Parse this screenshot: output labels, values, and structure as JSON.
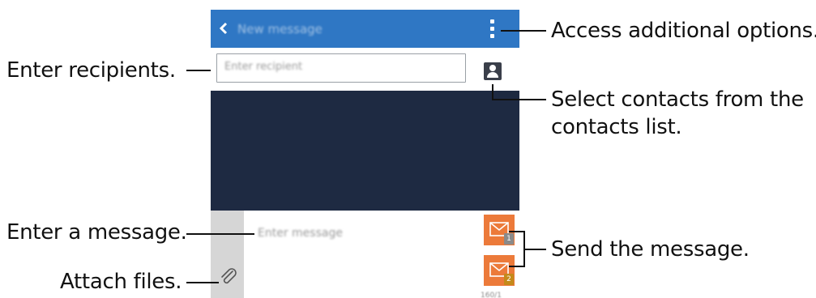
{
  "app": {
    "title": "New message",
    "back_icon": "chevron-left-icon",
    "overflow_icon": "more-vertical-icon"
  },
  "recipient": {
    "placeholder": "Enter recipient",
    "contacts_icon": "contact-person-icon"
  },
  "composer": {
    "placeholder": "Enter message",
    "attach_icon": "paperclip-icon",
    "send_buttons": [
      {
        "icon": "envelope-icon",
        "sim": "1"
      },
      {
        "icon": "envelope-icon",
        "sim": "2"
      }
    ],
    "counter": "160/1"
  },
  "callouts": {
    "options": "Access additional options.",
    "recipients": "Enter recipients.",
    "contacts_line1": "Select contacts from the",
    "contacts_line2": "contacts list.",
    "message": "Enter a message.",
    "send": "Send the message.",
    "attach": "Attach files."
  },
  "colors": {
    "actionbar": "#2f77c4",
    "content": "#1e2a42",
    "send": "#ec7a3a",
    "attach_column": "#d6d6d6"
  }
}
